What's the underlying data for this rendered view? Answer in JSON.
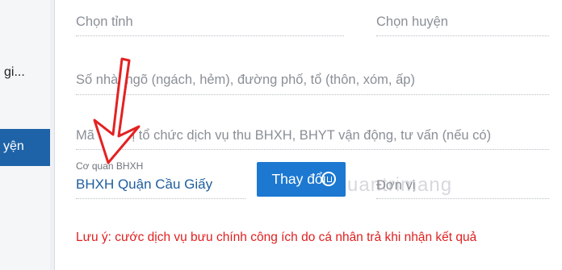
{
  "sidebar": {
    "items": [
      {
        "label": "gi..."
      },
      {
        "label": "yện"
      }
    ]
  },
  "form": {
    "province_placeholder": "Chọn tỉnh",
    "district_placeholder": "Chọn huyện",
    "address_placeholder": "Số nhà, ngõ (ngách, hẻm), đường phố, tổ (thôn, xóm, ấp)",
    "agency_code_placeholder": "Mã đơn vị tổ chức dịch vụ thu BHXH, BHYT vận động, tư vấn (nếu có)",
    "agency_label": "Cơ quan BHXH",
    "agency_value": "BHXH Quận Cầu Giấy",
    "change_button": "Thay đổi",
    "unit_label": "Đơn vị",
    "watermark": "uantrimang",
    "note": "Lưu ý: cước dịch vụ bưu chính công ích do cá nhân trả khi nhận kết quả"
  },
  "colors": {
    "sidebar_active": "#1e63a7",
    "button": "#1c78d1",
    "note": "#e02020",
    "arrow": "#e32222"
  }
}
